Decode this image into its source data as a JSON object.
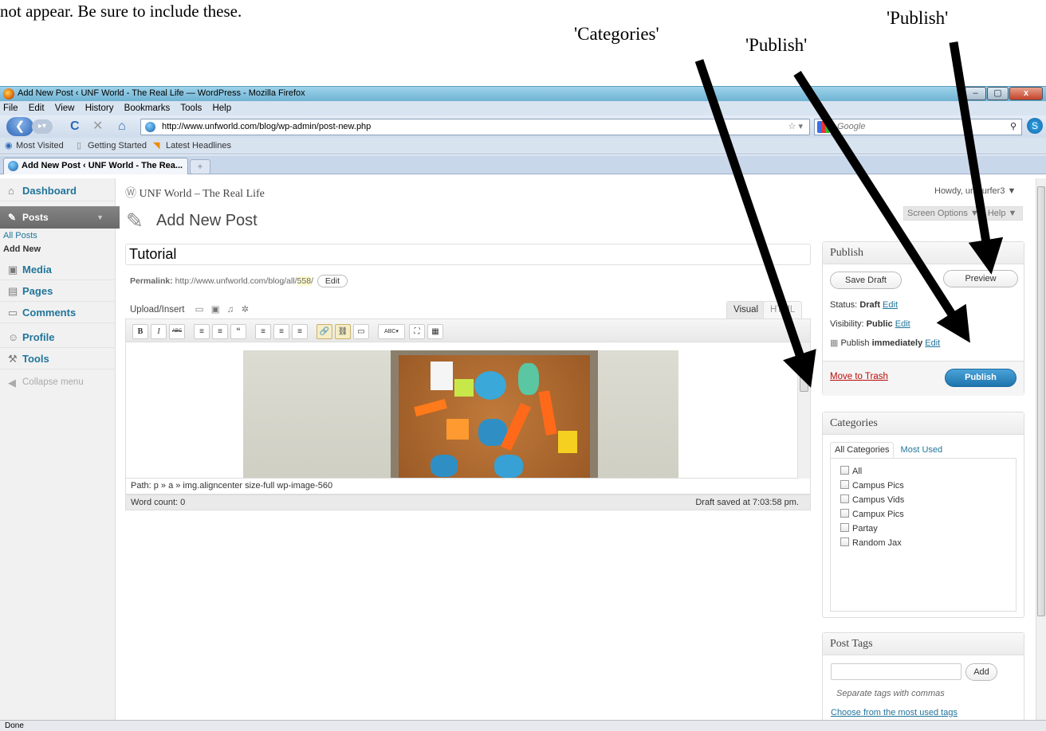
{
  "document": {
    "instruction_fragment": "not appear. Be sure to include these."
  },
  "annotations": {
    "categories_label": "'Categories'",
    "publish_label_1": "'Publish'",
    "publish_label_2": "'Publish'"
  },
  "window": {
    "title": "Add New Post ‹ UNF World - The Real Life — WordPress - Mozilla Firefox",
    "min": "–",
    "max": "▢",
    "close": "x"
  },
  "menubar": [
    "File",
    "Edit",
    "View",
    "History",
    "Bookmarks",
    "Tools",
    "Help"
  ],
  "nav": {
    "url": "http://www.unfworld.com/blog/wp-admin/post-new.php",
    "search_placeholder": "Google"
  },
  "bookmarks": [
    "Most Visited",
    "Getting Started",
    "Latest Headlines"
  ],
  "tabs": [
    {
      "label": "Add New Post ‹ UNF World - The Rea..."
    }
  ],
  "wp": {
    "site_title": "UNF World – The Real Life",
    "howdy": "Howdy, unfsurfer3 ▼",
    "screen_options": "Screen Options ▼",
    "help": "Help ▼",
    "page_title": "Add New Post",
    "sidebar": {
      "dashboard": "Dashboard",
      "posts": "Posts",
      "all_posts": "All Posts",
      "add_new": "Add New",
      "media": "Media",
      "pages": "Pages",
      "comments": "Comments",
      "profile": "Profile",
      "tools": "Tools",
      "collapse": "Collapse menu"
    },
    "post_title": "Tutorial",
    "permalink_label": "Permalink:",
    "permalink_url": "http://www.unfworld.com/blog/all/",
    "permalink_id": "558",
    "permalink_edit": "Edit",
    "upload_insert": "Upload/Insert",
    "tab_visual": "Visual",
    "tab_html": "HTML",
    "toolbar_buttons": [
      "B",
      "I",
      "ABC",
      "≡",
      "≡",
      "“",
      "≡",
      "≡",
      "≡",
      "🔗",
      "⛓",
      "▭",
      "ABC▾",
      "⛶",
      "▦"
    ],
    "path": "Path: p » a » img.aligncenter size-full wp-image-560",
    "word_count": "Word count: 0",
    "draft_saved": "Draft saved at 7:03:58 pm.",
    "publish_box": {
      "title": "Publish",
      "save_draft": "Save Draft",
      "preview": "Preview",
      "status_label": "Status:",
      "status_value": "Draft",
      "visibility_label": "Visibility:",
      "visibility_value": "Public",
      "publish_label": "Publish",
      "publish_when": "immediately",
      "edit": "Edit",
      "move_to_trash": "Move to Trash",
      "publish_button": "Publish"
    },
    "categories_box": {
      "title": "Categories",
      "tab_all": "All Categories",
      "tab_most_used": "Most Used",
      "items": [
        "All",
        "Campus Pics",
        "Campus Vids",
        "Campux Pics",
        "Partay",
        "Random Jax"
      ]
    },
    "tags_box": {
      "title": "Post Tags",
      "add": "Add",
      "hint": "Separate tags with commas",
      "choose_link": "Choose from the most used tags"
    }
  },
  "status_bar": "Done",
  "colors": {
    "wp_link": "#21759b",
    "publish_button": "#1e74ad",
    "trash": "#bc0b0b"
  }
}
